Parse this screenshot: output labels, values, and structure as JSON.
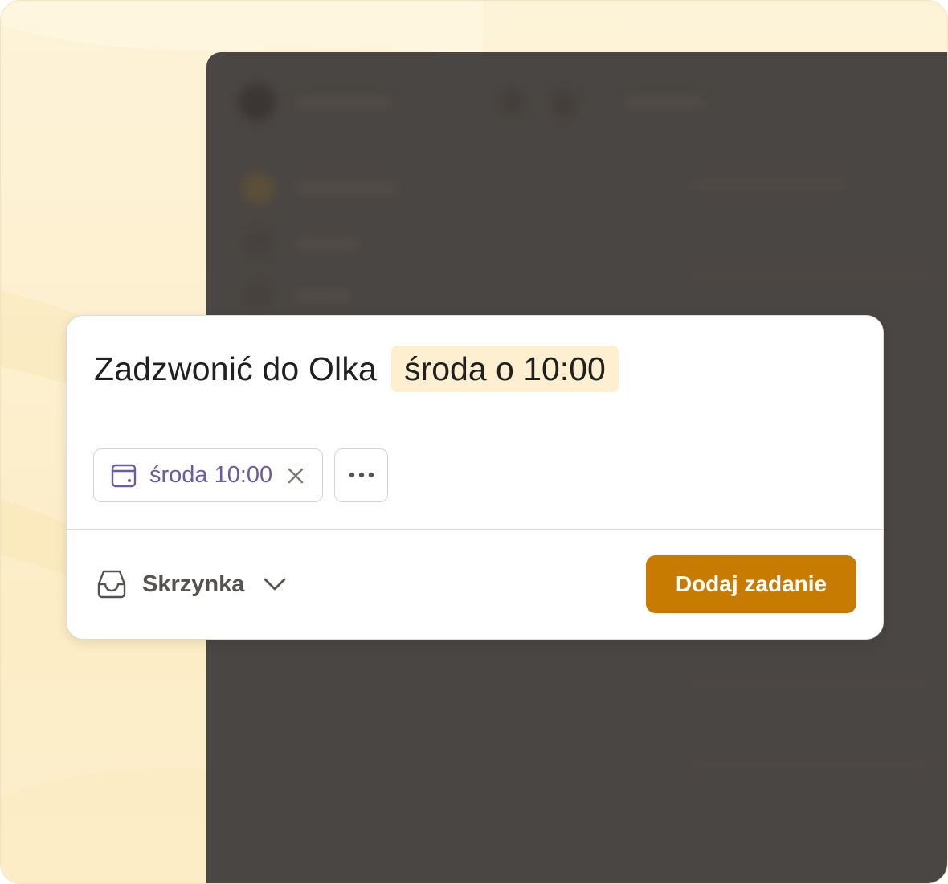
{
  "task": {
    "title": "Zadzwonić do Olka",
    "date_text": "środa o 10:00"
  },
  "chips": {
    "date_icon": "calendar-icon",
    "date_label": "środa 10:00",
    "remove_icon": "close-icon",
    "more_icon": "more-horizontal-icon"
  },
  "footer": {
    "project_icon": "inbox-icon",
    "project_label": "Skrzynka",
    "project_chevron": "chevron-down-icon",
    "submit_label": "Dodaj zadanie"
  },
  "colors": {
    "accent": "#c77b00",
    "date_highlight": "#fdefcf",
    "date_chip_text": "#6c5aa7",
    "backdrop": "#4a4643",
    "background": "#fdf3d8"
  }
}
